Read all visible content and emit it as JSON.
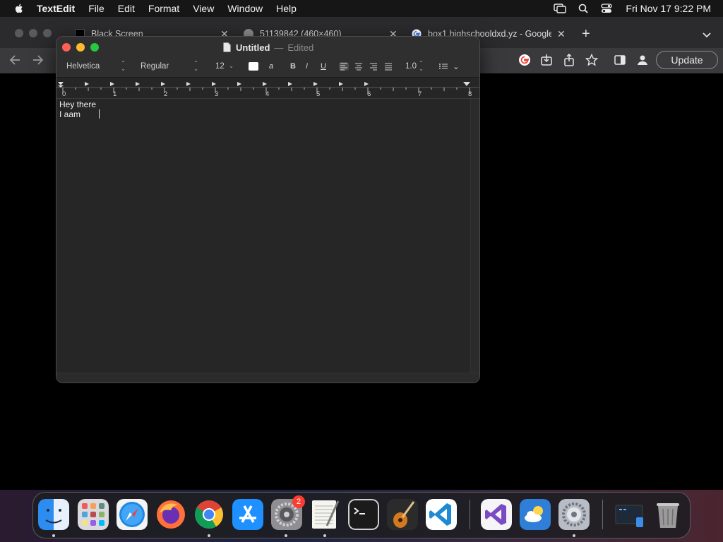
{
  "menubar": {
    "apple_icon": "apple-logo-icon",
    "app_name": "TextEdit",
    "items": [
      "File",
      "Edit",
      "Format",
      "View",
      "Window",
      "Help"
    ],
    "status_icons": [
      "screen-mirroring-icon",
      "spotlight-search-icon",
      "control-center-icon"
    ],
    "clock": "Fri Nov 17  9:22 PM"
  },
  "browser": {
    "tabs": [
      {
        "title": "Black Screen",
        "favicon": "black-square-icon"
      },
      {
        "title": "51139842 (460×460)",
        "favicon": "globe-icon"
      },
      {
        "title": "box1.highschooldxd.yz - Google",
        "favicon": "google-icon"
      }
    ],
    "new_tab_label": "+",
    "toolbar_icons": [
      "back-arrow-icon",
      "forward-arrow-icon",
      "google-lens-icon",
      "install-app-icon",
      "share-icon",
      "bookmark-star-icon",
      "side-panel-icon",
      "profile-icon"
    ],
    "update_label": "Update"
  },
  "textedit": {
    "title": "Untitled",
    "separator": "—",
    "status": "Edited",
    "font_family": "Helvetica",
    "font_style": "Regular",
    "font_size": "12",
    "style_buttons": {
      "bold": "B",
      "italic": "I",
      "underline": "U"
    },
    "highlight_label": "a",
    "line_spacing": "1.0",
    "ruler_numbers": [
      "0",
      "1",
      "2",
      "3",
      "4",
      "5",
      "6",
      "7",
      "8"
    ],
    "document_lines": [
      "Hey there",
      "I aam"
    ],
    "colors": {
      "text_color": "#ffffff",
      "close": "#ff5f57",
      "minimize": "#febc2e",
      "zoom": "#28c840"
    }
  },
  "dock": {
    "apps": [
      "Finder",
      "Launchpad",
      "Safari",
      "Firefox",
      "Google Chrome",
      "App Store",
      "System Preferences",
      "TextEdit",
      "Terminal",
      "GarageBand",
      "Visual Studio Code",
      "Visual Studio",
      "Weather",
      "System Settings",
      "Downloads",
      "Trash"
    ],
    "notification_badge": "2"
  }
}
